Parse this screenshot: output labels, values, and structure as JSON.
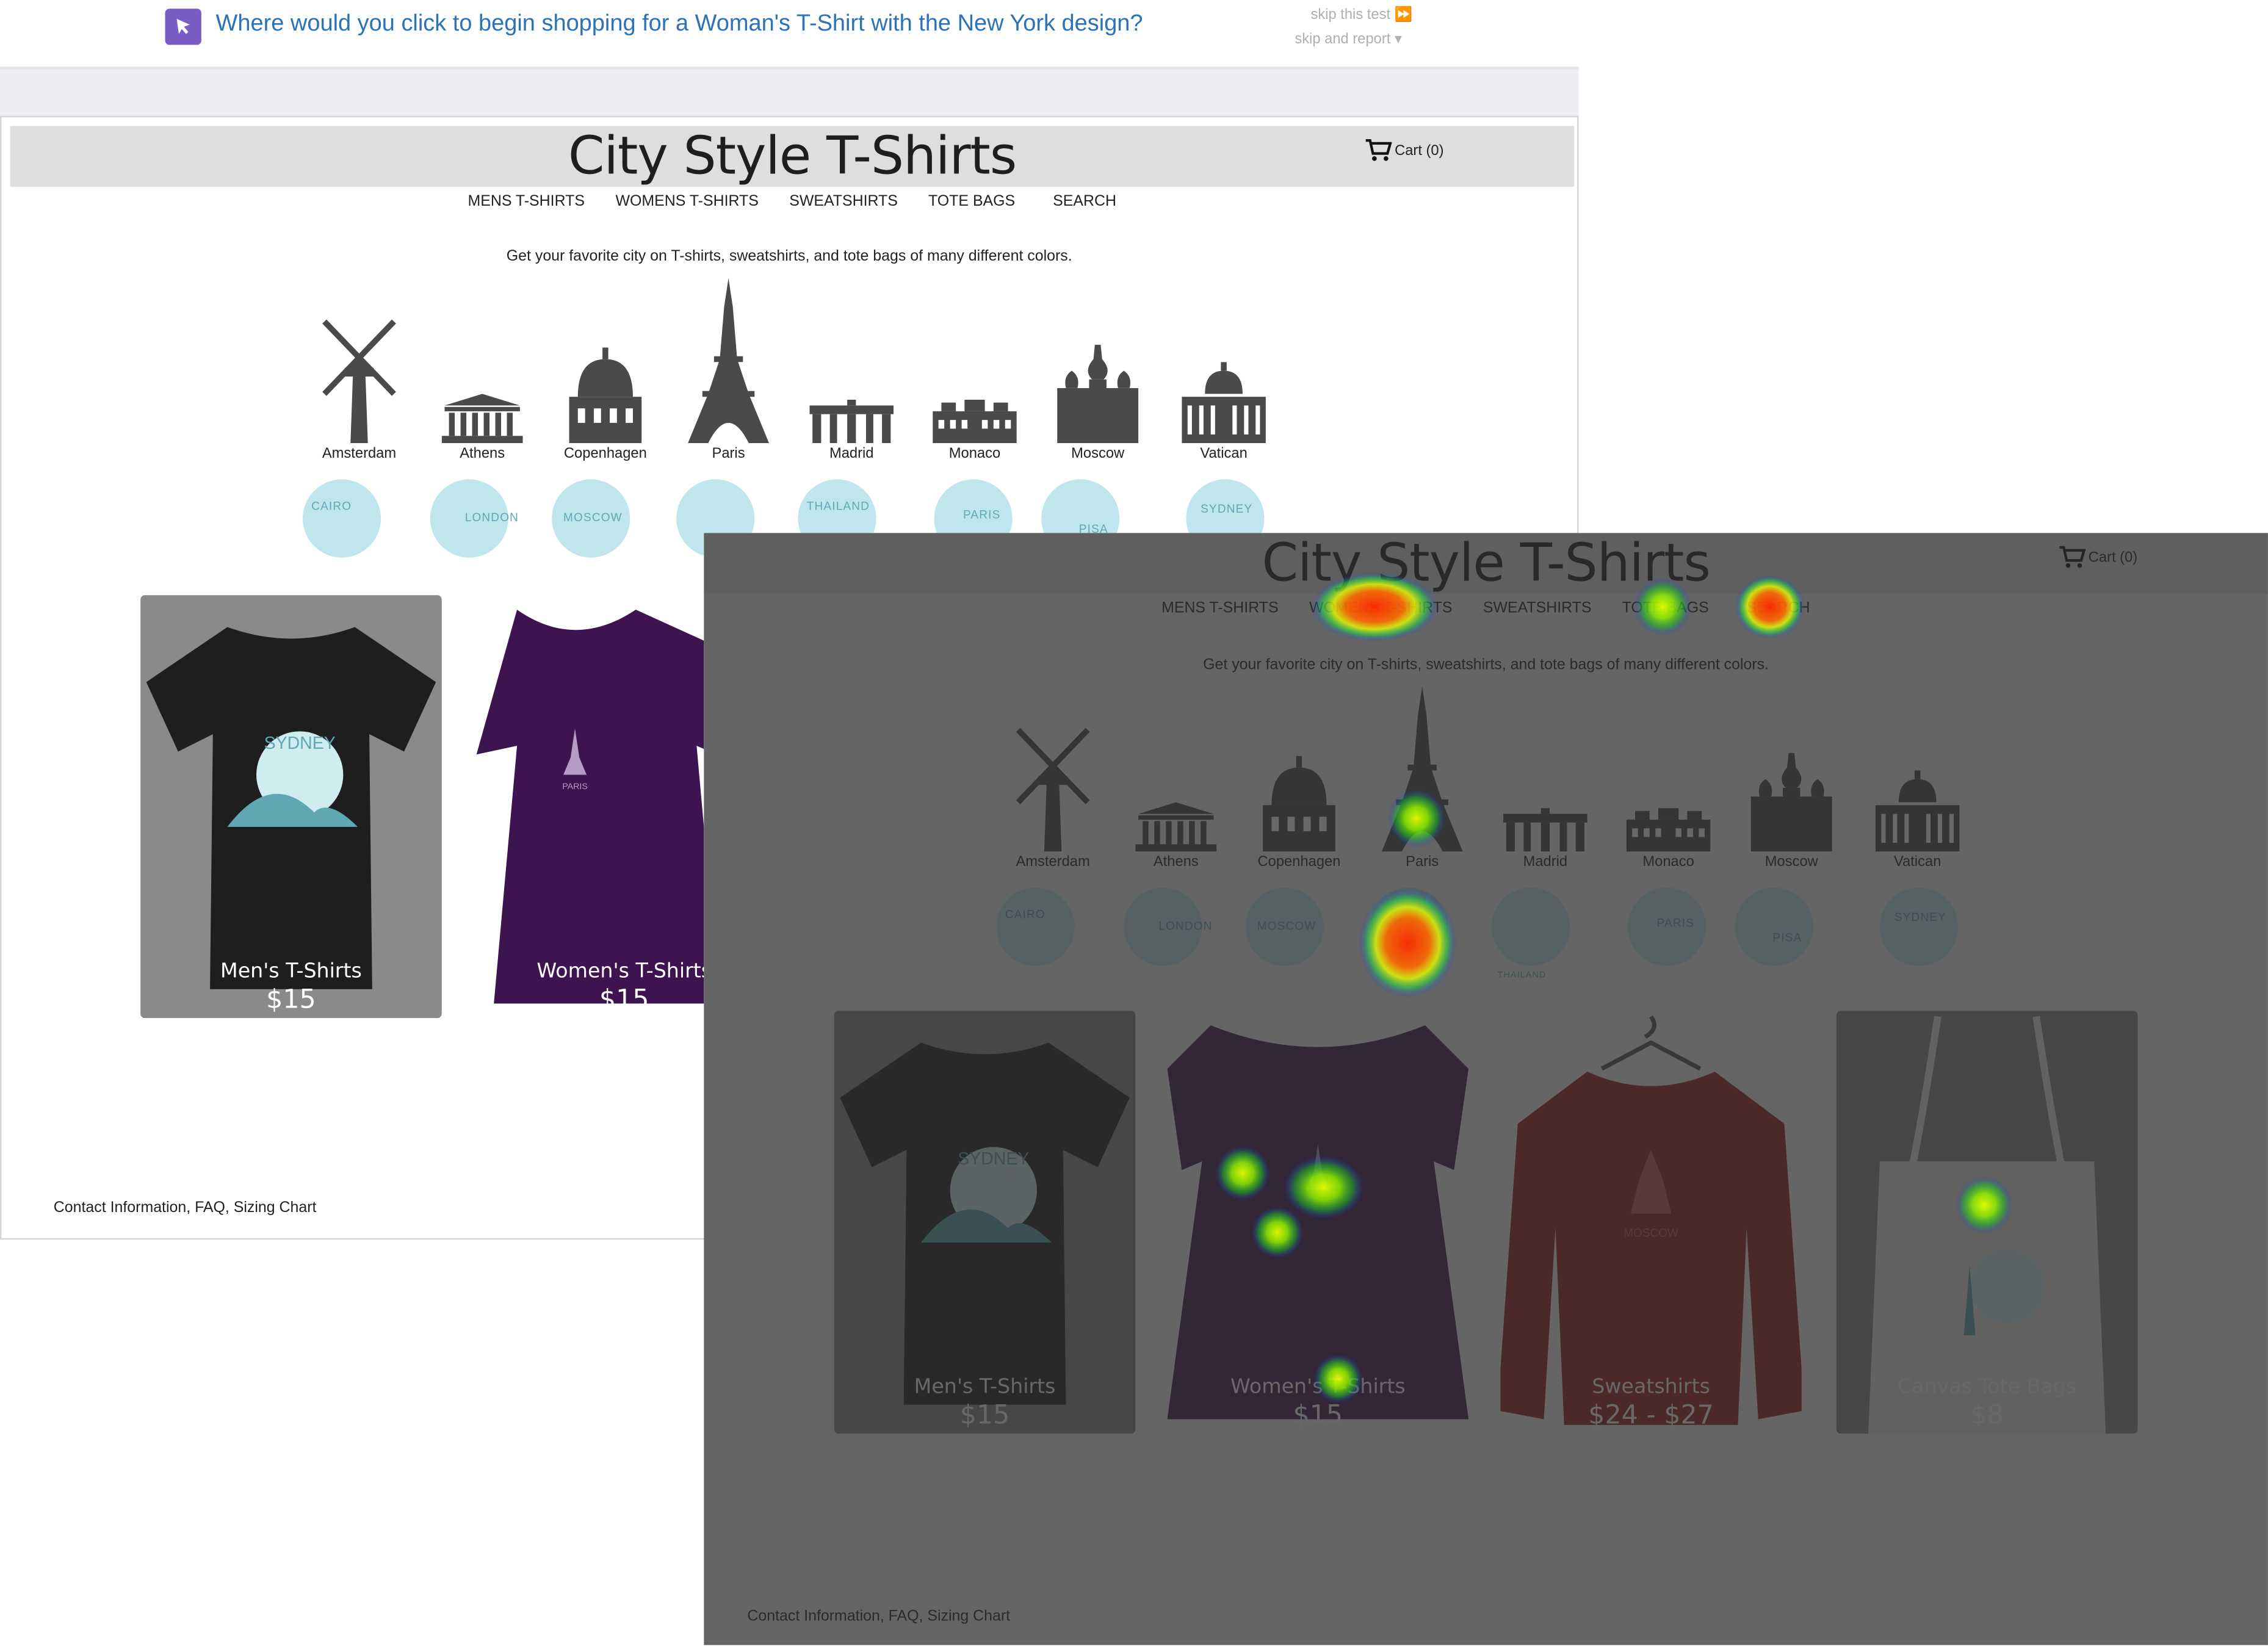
{
  "task": {
    "question": "Where would you click to begin shopping for a Woman's T-Shirt with the New York design?",
    "skip_test": "skip this test",
    "skip_report": "skip and report"
  },
  "site": {
    "title": "City Style T-Shirts",
    "cart": "Cart (0)",
    "nav": [
      "MENS T-SHIRTS",
      "WOMENS T-SHIRTS",
      "SWEATSHIRTS",
      "TOTE BAGS",
      "SEARCH"
    ],
    "tagline": "Get your favorite city on T-shirts, sweatshirts, and tote bags of many different colors.",
    "cities": [
      "Amsterdam",
      "Athens",
      "Copenhagen",
      "Paris",
      "Madrid",
      "Monaco",
      "Moscow",
      "Vatican"
    ],
    "badges": [
      "CAIRO",
      "LONDON",
      "MOSCOW",
      "",
      "THAILAND",
      "PARIS",
      "PISA",
      "SYDNEY"
    ],
    "products": [
      {
        "name": "Men's T-Shirts",
        "price": "$15",
        "color": "#1e1e1e",
        "bg": "#8a8a8a",
        "badge": "SYDNEY"
      },
      {
        "name": "Women's T-Shirts",
        "price": "$15",
        "color": "#3e1450",
        "bg": "#ffffff",
        "badge": "PARIS"
      },
      {
        "name": "Sweatshirts",
        "price": "$24 - $27",
        "color": "#9c1e1e",
        "bg": "#ffffff",
        "badge": "MOSCOW"
      },
      {
        "name": "Canvas Tote Bags",
        "price": "$8",
        "color": "#ece9e1",
        "bg": "#8a8a8a",
        "badge": ""
      }
    ],
    "footer": "Contact Information, FAQ, Sizing Chart"
  }
}
